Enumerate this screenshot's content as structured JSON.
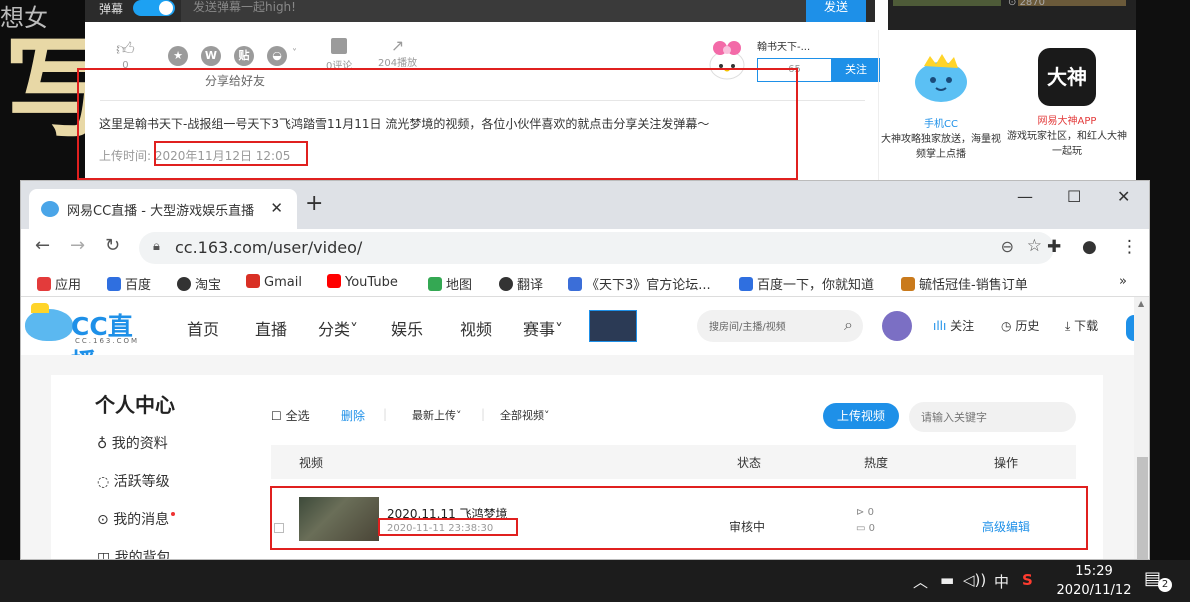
{
  "background": {
    "left_art_top": "想女",
    "left_art_big": "写",
    "danmu": {
      "label": "弹幕",
      "placeholder": "发送弹幕一起high!",
      "send_label": "发送"
    },
    "top_thumb_count": "2870",
    "actions": {
      "like_count": "0",
      "share_label": "分享给好友",
      "comments": "0评论",
      "plays": "204播放",
      "uploader_name": "翰书天下-...",
      "fans_count": "65",
      "follow_label": "关注"
    },
    "description": "这里是翰书天下-战报组一号天下3飞鸿踏雪11月11日 流光梦境的视频，各位小伙伴喜欢的就点击分享关注发弹幕～",
    "upload_time_label": "上传时间:",
    "upload_time_value": "2020年11月12日 12:05",
    "promos": [
      {
        "name": "手机CC",
        "name_color": "#1e90e8",
        "desc": "大神攻略独家放送，海量视频掌上点播"
      },
      {
        "name": "网易大神APP",
        "name_color": "#e33b3b",
        "desc": "游戏玩家社区，和红人大神一起玩",
        "logo_text": "大神"
      }
    ]
  },
  "browser": {
    "tab_title": "网易CC直播 - 大型游戏娱乐直播",
    "url": "cc.163.com/user/video/",
    "bookmarks": [
      {
        "label": "应用",
        "color": "#e33b3b"
      },
      {
        "label": "百度",
        "color": "#2f6fe0"
      },
      {
        "label": "淘宝",
        "color": "#333333"
      },
      {
        "label": "Gmail",
        "color": "#d93025"
      },
      {
        "label": "YouTube",
        "color": "#ff0000"
      },
      {
        "label": "地图",
        "color": "#34a853"
      },
      {
        "label": "翻译",
        "color": "#333333"
      },
      {
        "label": "《天下3》官方论坛...",
        "color": "#3b6ed8"
      },
      {
        "label": "百度一下，你就知道",
        "color": "#2f6fe0"
      },
      {
        "label": "毓恬冠佳-销售订单",
        "color": "#c97a1c"
      }
    ],
    "more_bookmarks": "»"
  },
  "site": {
    "logo_text": "CC直播",
    "logo_sub": "CC.163.COM",
    "nav": [
      "首页",
      "直播",
      "分类˅",
      "娱乐",
      "视频",
      "赛事˅"
    ],
    "search_placeholder": "搜房间/主播/视频",
    "links": {
      "follow": "关注",
      "history": "历史",
      "download": "下载"
    }
  },
  "user_center": {
    "title": "个人中心",
    "items": [
      "我的资料",
      "活跃等级",
      "我的消息",
      "我的背包"
    ]
  },
  "video_panel": {
    "select_all": "全选",
    "delete": "删除",
    "sort": "最新上传˅",
    "filter": "全部视频˅",
    "upload_button": "上传视频",
    "keyword_placeholder": "请输入关键字",
    "columns": [
      "视频",
      "状态",
      "热度",
      "操作"
    ],
    "rows": [
      {
        "title": "2020.11.11 飞鸿梦境",
        "date": "2020-11-11 23:38:30",
        "status": "审核中",
        "plays": "0",
        "danmu": "0",
        "action": "高级编辑"
      }
    ]
  },
  "taskbar": {
    "ime": "中",
    "time": "15:29",
    "date": "2020/11/12",
    "notif_count": "2"
  }
}
